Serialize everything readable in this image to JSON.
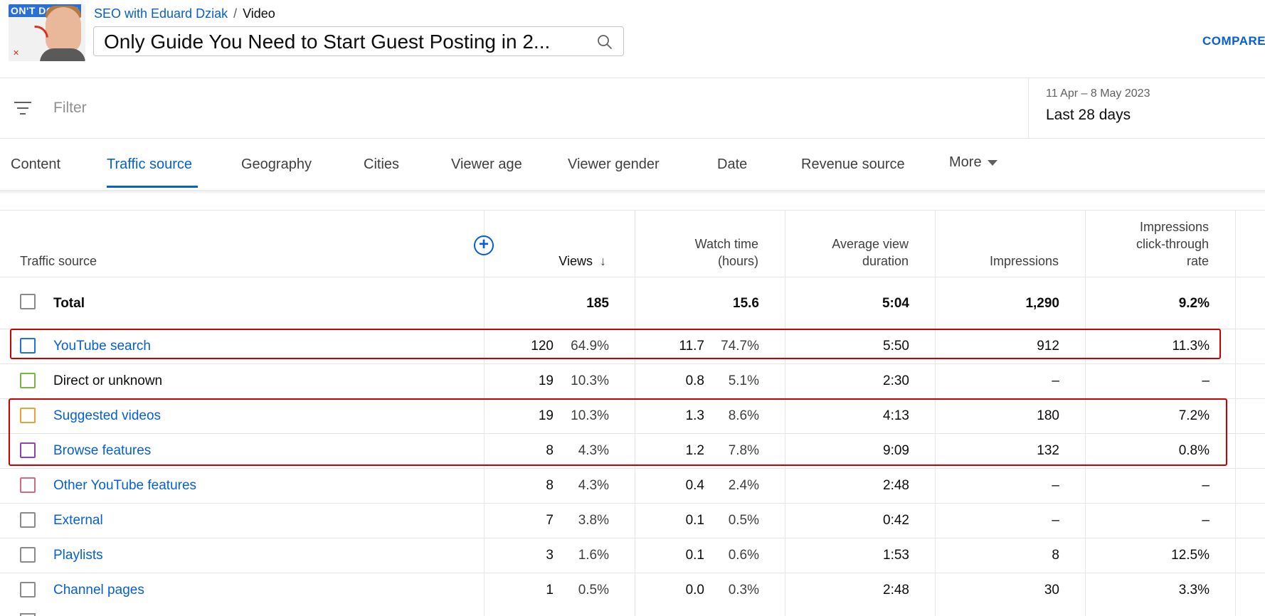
{
  "header": {
    "thumbnail_text": "ON'T DO HIS!",
    "channel": "SEO with Eduard Dziak",
    "separator": "/",
    "page": "Video",
    "video_title": "Only Guide You Need to Start Guest Posting in 2...",
    "compare_label": "COMPARE"
  },
  "filter": {
    "placeholder": "Filter",
    "date_range": "11 Apr – 8 May 2023",
    "date_label": "Last 28 days"
  },
  "tabs": [
    {
      "label": "Content"
    },
    {
      "label": "Traffic source",
      "active": true
    },
    {
      "label": "Geography"
    },
    {
      "label": "Cities"
    },
    {
      "label": "Viewer age"
    },
    {
      "label": "Viewer gender"
    },
    {
      "label": "Date"
    },
    {
      "label": "Revenue source"
    },
    {
      "label": "More"
    }
  ],
  "table": {
    "headers": {
      "source": "Traffic source",
      "views": "Views",
      "watch_time_1": "Watch time",
      "watch_time_2": "(hours)",
      "avd_1": "Average view",
      "avd_2": "duration",
      "impressions": "Impressions",
      "ctr_1": "Impressions",
      "ctr_2": "click-through",
      "ctr_3": "rate",
      "add_metric": "+"
    },
    "total": {
      "source": "Total",
      "views": "185",
      "watch": "15.6",
      "avd": "5:04",
      "impressions": "1,290",
      "ctr": "9.2%"
    },
    "rows": [
      {
        "source": "YouTube search",
        "color": "#1a73e8",
        "views": "120",
        "views_pct": "64.9%",
        "watch": "11.7",
        "watch_pct": "74.7%",
        "avd": "5:50",
        "impressions": "912",
        "ctr": "11.3%"
      },
      {
        "source": "Direct or unknown",
        "color": "#7cb342",
        "views": "19",
        "views_pct": "10.3%",
        "watch": "0.8",
        "watch_pct": "5.1%",
        "avd": "2:30",
        "impressions": "–",
        "ctr": "–"
      },
      {
        "source": "Suggested videos",
        "color": "#e6a13a",
        "views": "19",
        "views_pct": "10.3%",
        "watch": "1.3",
        "watch_pct": "8.6%",
        "avd": "4:13",
        "impressions": "180",
        "ctr": "7.2%"
      },
      {
        "source": "Browse features",
        "color": "#8e44ad",
        "views": "8",
        "views_pct": "4.3%",
        "watch": "1.2",
        "watch_pct": "7.8%",
        "avd": "9:09",
        "impressions": "132",
        "ctr": "0.8%"
      },
      {
        "source": "Other YouTube features",
        "color": "#d36a83",
        "views": "8",
        "views_pct": "4.3%",
        "watch": "0.4",
        "watch_pct": "2.4%",
        "avd": "2:48",
        "impressions": "–",
        "ctr": "–"
      },
      {
        "source": "External",
        "color": "#8a8a8a",
        "views": "7",
        "views_pct": "3.8%",
        "watch": "0.1",
        "watch_pct": "0.5%",
        "avd": "0:42",
        "impressions": "–",
        "ctr": "–"
      },
      {
        "source": "Playlists",
        "color": "#8a8a8a",
        "views": "3",
        "views_pct": "1.6%",
        "watch": "0.1",
        "watch_pct": "0.6%",
        "avd": "1:53",
        "impressions": "8",
        "ctr": "12.5%"
      },
      {
        "source": "Channel pages",
        "color": "#8a8a8a",
        "views": "1",
        "views_pct": "0.5%",
        "watch": "0.0",
        "watch_pct": "0.3%",
        "avd": "2:48",
        "impressions": "30",
        "ctr": "3.3%"
      }
    ]
  },
  "colors": {
    "accent": "#065fd4",
    "highlight_box": "#cc0000"
  }
}
